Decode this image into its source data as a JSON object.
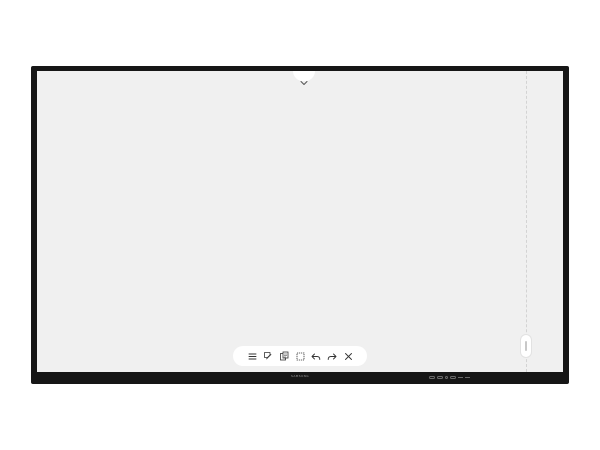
{
  "device": {
    "brand": "SAMSUNG"
  },
  "screen": {
    "background_color": "#f0f0f0",
    "bezel_color": "#161616"
  },
  "top_handle": {
    "icon": "chevron-down-icon"
  },
  "toolbar": {
    "tools": [
      {
        "name": "menu",
        "icon": "menu-icon"
      },
      {
        "name": "pen",
        "icon": "pen-icon"
      },
      {
        "name": "paste",
        "icon": "clipboard-icon"
      },
      {
        "name": "select",
        "icon": "selection-icon"
      },
      {
        "name": "undo",
        "icon": "undo-icon"
      },
      {
        "name": "redo",
        "icon": "redo-icon"
      },
      {
        "name": "close",
        "icon": "close-icon"
      }
    ]
  }
}
